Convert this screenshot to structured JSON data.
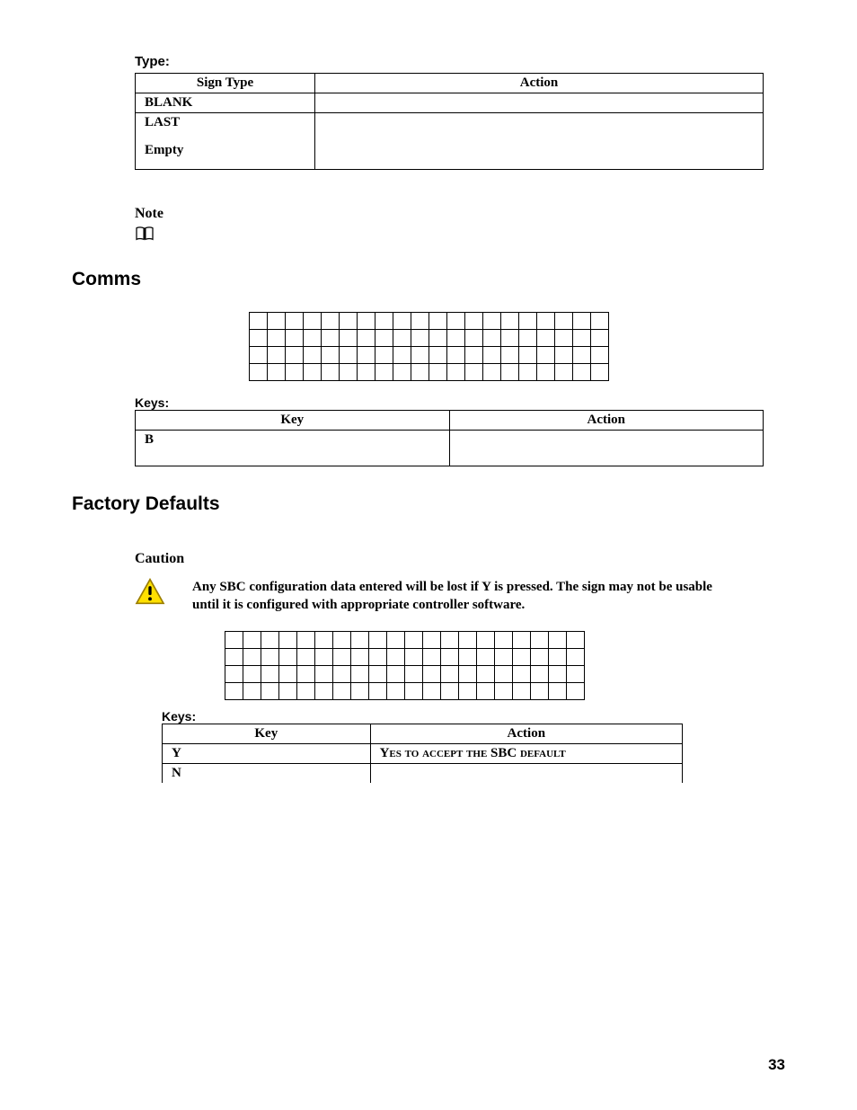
{
  "type_section": {
    "label": "Type:",
    "header": {
      "col1": "Sign Type",
      "col2": "Action"
    },
    "rows": [
      {
        "col1": "BLANK",
        "col2": ""
      },
      {
        "col1": "LAST",
        "col2": ""
      },
      {
        "col1": "Empty",
        "col2": ""
      }
    ]
  },
  "note": {
    "title": "Note"
  },
  "comms": {
    "heading": "Comms",
    "keys_label": "Keys:",
    "keys_header": {
      "col1": "Key",
      "col2": "Action"
    },
    "keys_rows": [
      {
        "col1": "B",
        "col2": ""
      }
    ]
  },
  "factory": {
    "heading": "Factory Defaults",
    "caution_title": "Caution",
    "caution_text": "Any SBC configuration data entered will be lost if Y is pressed. The sign may not be usable until it is configured with appropriate controller software.",
    "keys_label": "Keys:",
    "keys_header": {
      "col1": "Key",
      "col2": "Action"
    },
    "keys_rows": [
      {
        "col1": "Y",
        "col2": "Yes to accept the SBC default"
      },
      {
        "col1": "N",
        "col2": ""
      }
    ]
  },
  "page_number": "33"
}
